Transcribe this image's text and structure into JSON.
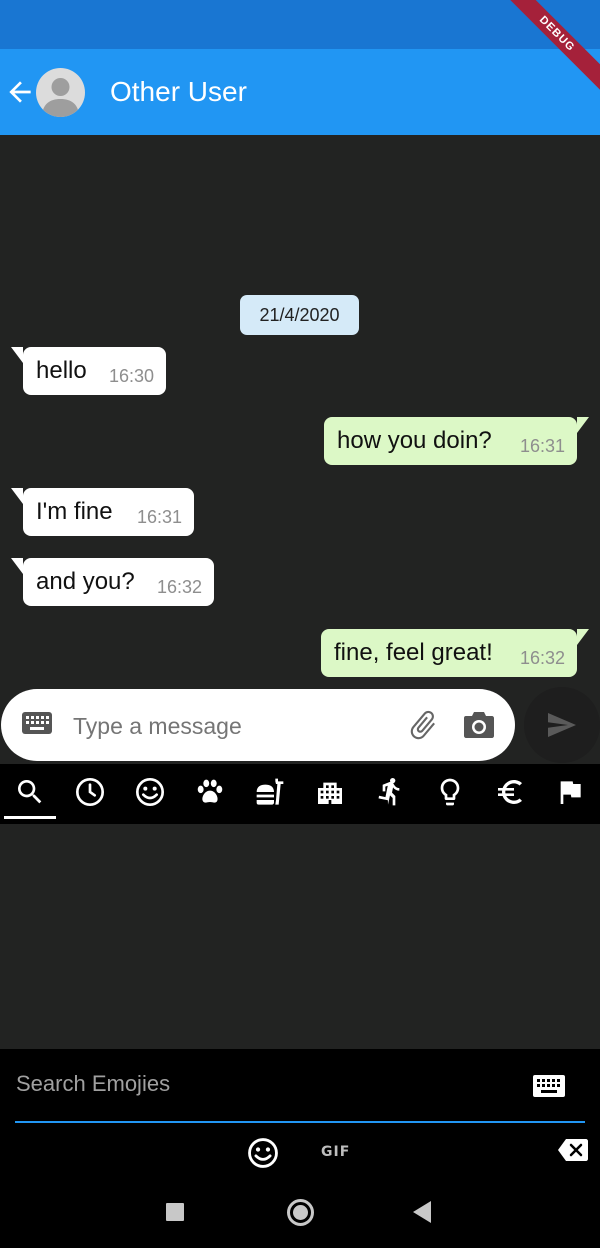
{
  "header": {
    "title": "Other User",
    "back_icon": "arrow-left-icon",
    "avatar_icon": "person-avatar-icon"
  },
  "debug_banner": "DEBUG",
  "chat": {
    "date": "21/4/2020",
    "messages": [
      {
        "text": "hello",
        "time": "16:30",
        "direction": "incoming"
      },
      {
        "text": "how you doin?",
        "time": "16:31",
        "direction": "outgoing"
      },
      {
        "text": "I'm fine",
        "time": "16:31",
        "direction": "incoming"
      },
      {
        "text": "and you?",
        "time": "16:32",
        "direction": "incoming"
      },
      {
        "text": "fine, feel great!",
        "time": "16:32",
        "direction": "outgoing"
      }
    ]
  },
  "composer": {
    "placeholder": "Type a message",
    "left_icon": "keyboard-icon",
    "attach_icon": "paperclip-icon",
    "camera_icon": "camera-icon",
    "send_icon": "send-icon"
  },
  "emoji_tabs": [
    {
      "icon": "search-icon",
      "selected": true
    },
    {
      "icon": "clock-icon",
      "selected": false
    },
    {
      "icon": "smiley-icon",
      "selected": false
    },
    {
      "icon": "paw-icon",
      "selected": false
    },
    {
      "icon": "food-icon",
      "selected": false
    },
    {
      "icon": "building-icon",
      "selected": false
    },
    {
      "icon": "running-person-icon",
      "selected": false
    },
    {
      "icon": "lightbulb-icon",
      "selected": false
    },
    {
      "icon": "euro-icon",
      "selected": false
    },
    {
      "icon": "flag-icon",
      "selected": false
    }
  ],
  "emoji_search": {
    "placeholder": "Search Emojies",
    "keyboard_icon": "keyboard-icon"
  },
  "emoji_footer": {
    "smiley_icon": "smiley-icon",
    "gif_label": "GIF",
    "backspace_icon": "backspace-icon"
  },
  "nav_bar": {
    "recents_icon": "square-icon",
    "home_icon": "circle-home-icon",
    "back_icon": "triangle-back-icon"
  },
  "colors": {
    "app_bar": "#2196F3",
    "status_bar": "#1976D2",
    "chat_background": "#222322",
    "outgoing_bubble": "#DCF8C6",
    "incoming_bubble": "#FFFFFF",
    "date_chip": "#D5EAF8",
    "accent": "#2196F3"
  }
}
